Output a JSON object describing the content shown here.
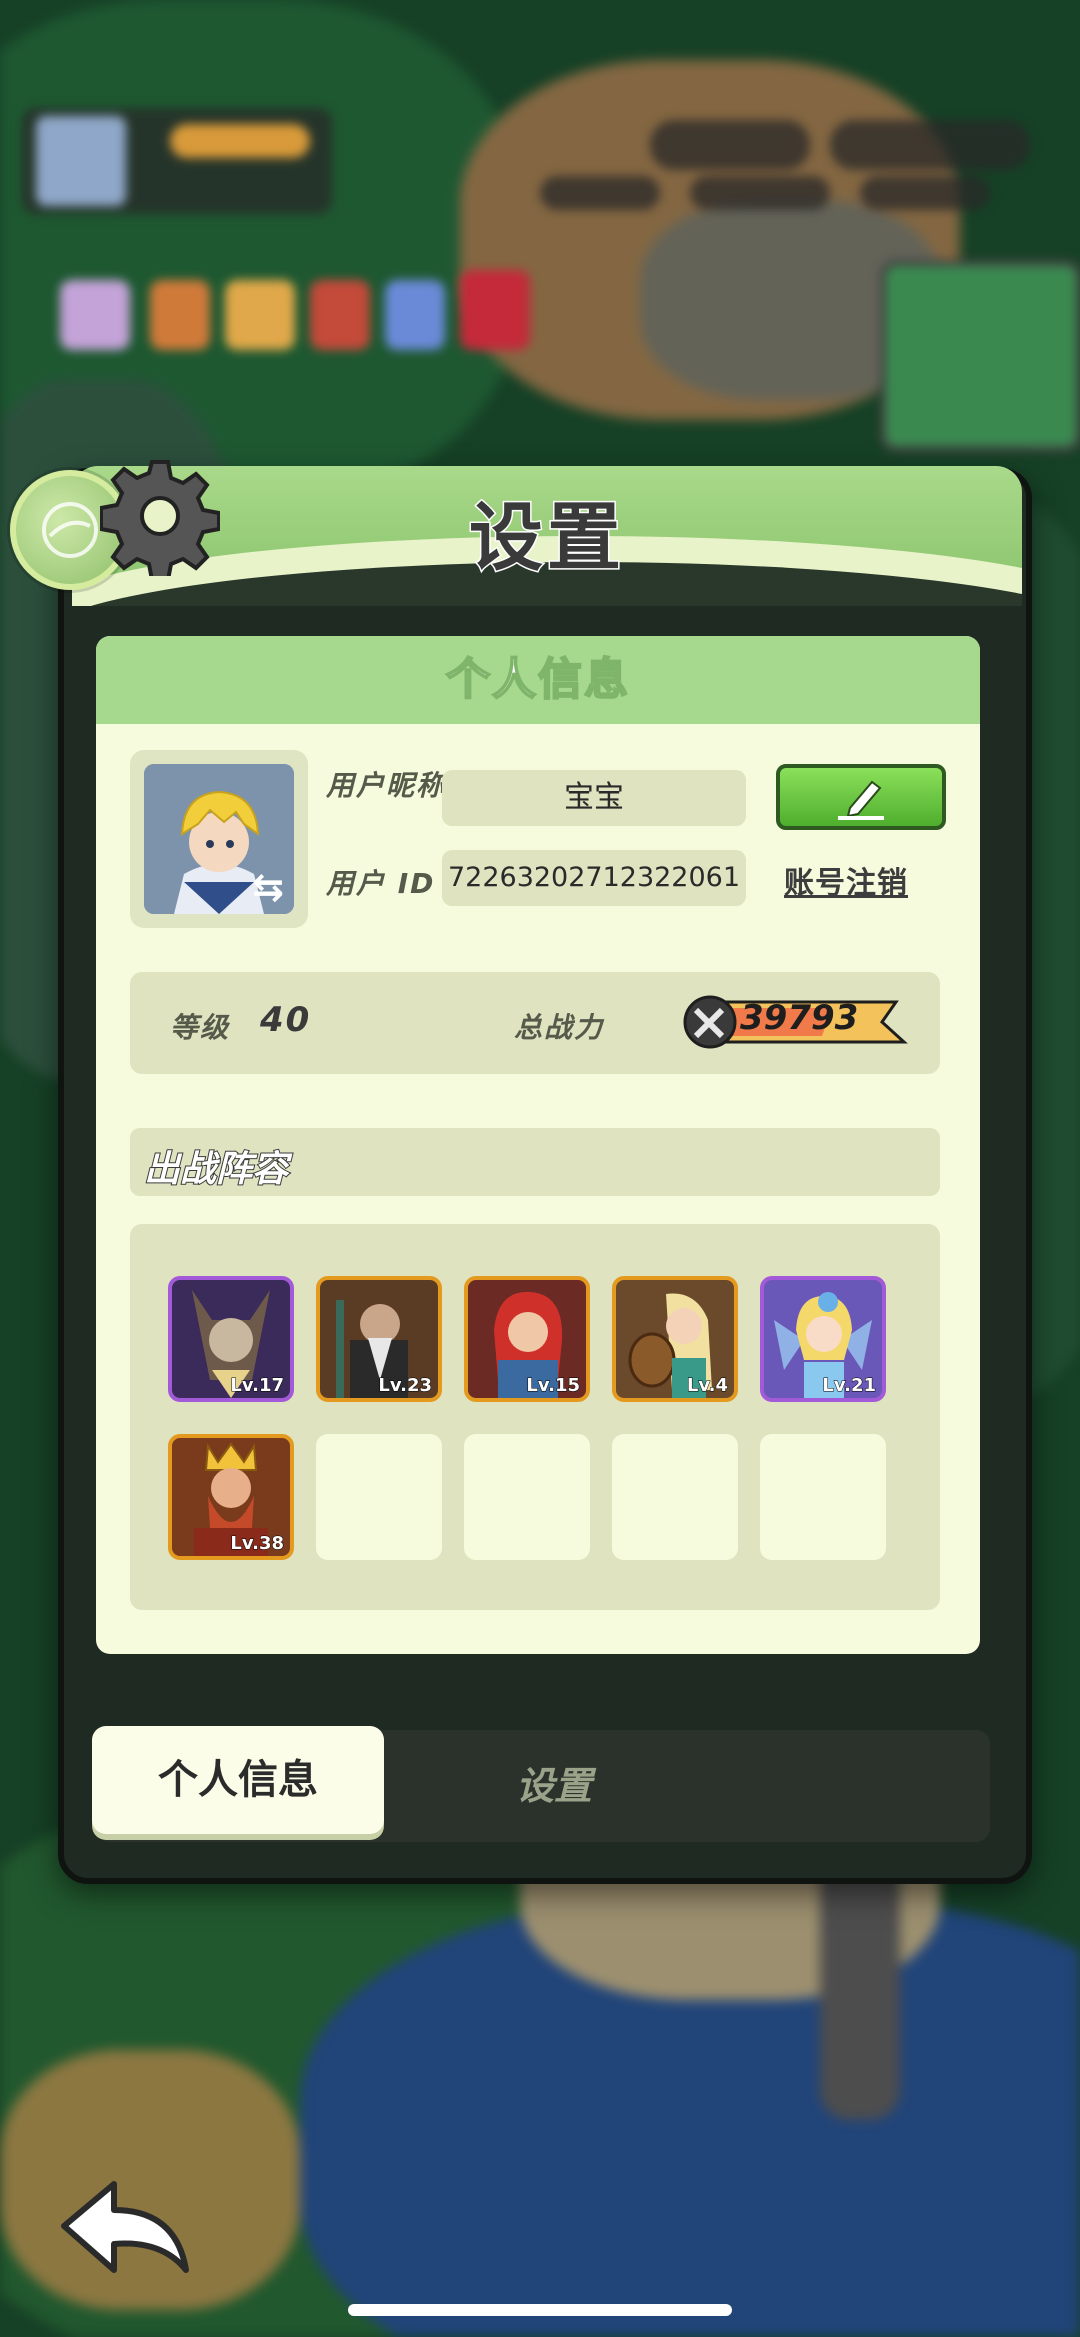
{
  "panel": {
    "title": "设置"
  },
  "card": {
    "header": "个人信息",
    "nickname_label": "用户昵称",
    "nickname_value": "宝宝",
    "id_label": "用户 ID",
    "id_value": "72263202712322061",
    "logout_link": "账号注销",
    "level_label": "等级",
    "level_value": "40",
    "power_label": "总战力",
    "power_value": "39793",
    "lineup_title": "出战阵容",
    "lineup": [
      {
        "level": "Lv.17",
        "frame": "#a35ad8",
        "bg": "#3b2b5a",
        "icon": "goat-demon-icon"
      },
      {
        "level": "Lv.23",
        "frame": "#e39a1f",
        "bg": "#5a3b24",
        "icon": "monk-hero-icon"
      },
      {
        "level": "Lv.15",
        "frame": "#e39a1f",
        "bg": "#6b2a24",
        "icon": "red-hair-hero-icon"
      },
      {
        "level": "Lv.4",
        "frame": "#e39a1f",
        "bg": "#6a4a2a",
        "icon": "bard-hero-icon"
      },
      {
        "level": "Lv.21",
        "frame": "#a35ad8",
        "bg": "#6a58b8",
        "icon": "fairy-hero-icon"
      },
      {
        "level": "Lv.38",
        "frame": "#e39a1f",
        "bg": "#7a3a1c",
        "icon": "king-hero-icon"
      }
    ]
  },
  "tabs": {
    "active": "个人信息",
    "inactive": "设置"
  },
  "colors": {
    "accent_green": "#a6d98e",
    "card_bg": "#f6fbdd",
    "field_bg": "#dfe3bf",
    "power_orange": "#f3a24a"
  }
}
